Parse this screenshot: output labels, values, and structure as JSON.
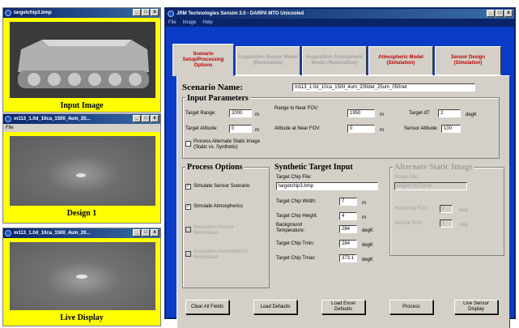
{
  "windows": {
    "input": {
      "title": "targetchip3.bmp",
      "caption": "Input Image"
    },
    "design": {
      "title": "m113_1.0d_10ca_150ll_4um_20...",
      "menu": "File",
      "caption": "Design 1"
    },
    "live": {
      "title": "m113_1.0d_10ca_150ll_4um_20...",
      "caption": "Live Display"
    }
  },
  "main": {
    "title": "JRM Technologies  Sensim 3.0 - DARPA MTO Unicooled",
    "menu": [
      "File",
      "Image",
      "Help"
    ],
    "tabs": [
      {
        "label": "Scenario Setup/Processing Options",
        "state": "active-red"
      },
      {
        "label": "Acquisition Sensor Model (Restoration)",
        "state": "disabled"
      },
      {
        "label": "Acquisition Atmospheric Model (Restoration)",
        "state": "disabled"
      },
      {
        "label": "Atmospheric Model (Simulation)",
        "state": "red"
      },
      {
        "label": "Sensor Design (Simulation)",
        "state": "red"
      }
    ],
    "scenario_name_label": "Scenario Name:",
    "scenario_name_value": "m113_1.0d_10ca_150ll_4um_200det_25um_050net",
    "input_params": {
      "header": "Input Parameters",
      "target_range": {
        "label": "Target Range:",
        "value": "2000",
        "unit": "m"
      },
      "range_near_fov": {
        "label": "Range to Near FOV:",
        "value": "1950",
        "unit": "m"
      },
      "target_dt": {
        "label": "Target dT:",
        "value": "2",
        "unit": "degK"
      },
      "target_altitude": {
        "label": "Target Altitude:",
        "value": "0",
        "unit": "m"
      },
      "altitude_near_fov": {
        "label": "Altitude at Near FOV:",
        "value": "0",
        "unit": "m"
      },
      "sensor_altitude": {
        "label": "Sensor Altitude:",
        "value": "100"
      },
      "alt_static_label": "Process Alternate Static Image (Static vs. Synthetic)"
    },
    "process_options": {
      "header": "Process Options",
      "items": [
        {
          "label": "Simulate Sensor Scenario",
          "checked": "✓"
        },
        {
          "label": "Simulate Atmospherics",
          "checked": "✓"
        },
        {
          "label": "Acquisition Sensor Restoration",
          "checked": ""
        },
        {
          "label": "Acquisition Atmospherics Restoration",
          "checked": ""
        }
      ]
    },
    "synthetic": {
      "header": "Synthetic Target Input",
      "chip_file_label": "Target Chip File:",
      "chip_file_value": "targetchip3.bmp",
      "width": {
        "label": "Target Chip Width:",
        "value": "7",
        "unit": "m"
      },
      "height": {
        "label": "Target Chip Height:",
        "value": "4",
        "unit": "m"
      },
      "bg_temp": {
        "label": "Background Temperature:",
        "value": "284",
        "unit": "degK"
      },
      "tmin": {
        "label": "Target Chip Tmin:",
        "value": "284",
        "unit": "degK"
      },
      "tmax": {
        "label": "Target Chip Tmax:",
        "value": "373.1",
        "unit": "degK"
      }
    },
    "alternate": {
      "header": "Alternate Static Image",
      "file_label": "Image File:",
      "file_value": "targetchip3.bmp",
      "hfov": {
        "label": "Horizontal FOV:",
        "value": "2",
        "unit": "deg"
      },
      "vfov": {
        "label": "Vertical FOV:",
        "value": "1",
        "unit": "deg"
      }
    },
    "buttons": {
      "clear": "Clear All Fields",
      "load_defaults": "Load Defaults",
      "load_excel": "Load Excel Defaults",
      "process": "Process",
      "live": "Live Sensor Display"
    }
  }
}
